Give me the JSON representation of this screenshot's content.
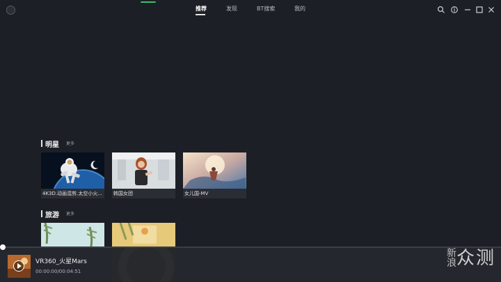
{
  "header": {
    "tabs": [
      {
        "label": "推荐",
        "active": true
      },
      {
        "label": "发现",
        "active": false
      },
      {
        "label": "BT搜索",
        "active": false
      },
      {
        "label": "我的",
        "active": false
      }
    ],
    "icons": [
      "search-icon",
      "info-icon",
      "minimize-icon",
      "maximize-icon",
      "close-icon"
    ]
  },
  "sections": [
    {
      "title": "明星",
      "more": "更多",
      "cards": [
        {
          "caption": "4K3D.动画混剪.太空小火..."
        },
        {
          "caption": "韩国女团"
        },
        {
          "caption": "女儿国-MV"
        }
      ]
    },
    {
      "title": "旅游",
      "more": "更多",
      "cards": [
        {
          "caption": ""
        },
        {
          "caption": ""
        }
      ]
    }
  ],
  "player": {
    "title": "VR360_火星Mars",
    "time": "00:00:00/00:04:51",
    "progress": 0.0
  },
  "watermark": {
    "text": "众测",
    "left_text": "新浪"
  },
  "colors": {
    "background": "#1c1f25",
    "accent": "#38c172",
    "caption_bg": "#2a2d34"
  }
}
